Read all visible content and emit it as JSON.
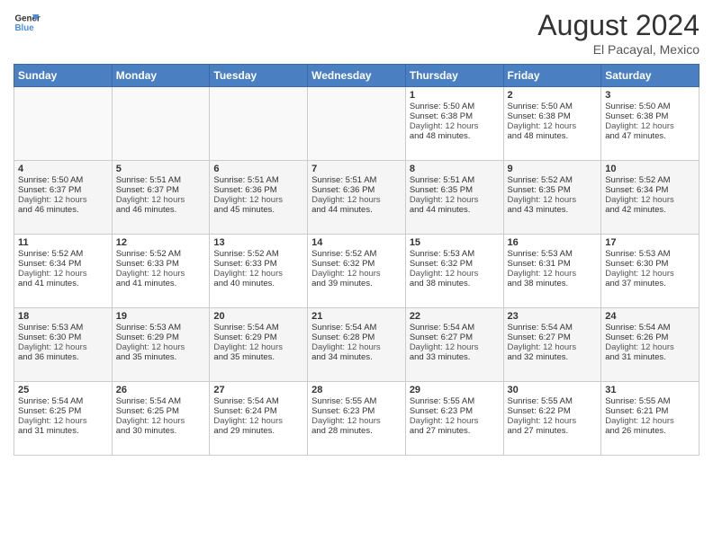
{
  "logo": {
    "line1": "General",
    "line2": "Blue"
  },
  "title": "August 2024",
  "location": "El Pacayal, Mexico",
  "days_of_week": [
    "Sunday",
    "Monday",
    "Tuesday",
    "Wednesday",
    "Thursday",
    "Friday",
    "Saturday"
  ],
  "weeks": [
    [
      {
        "day": "",
        "info": ""
      },
      {
        "day": "",
        "info": ""
      },
      {
        "day": "",
        "info": ""
      },
      {
        "day": "",
        "info": ""
      },
      {
        "day": "1",
        "info": "Sunrise: 5:50 AM\nSunset: 6:38 PM\nDaylight: 12 hours\nand 48 minutes."
      },
      {
        "day": "2",
        "info": "Sunrise: 5:50 AM\nSunset: 6:38 PM\nDaylight: 12 hours\nand 48 minutes."
      },
      {
        "day": "3",
        "info": "Sunrise: 5:50 AM\nSunset: 6:38 PM\nDaylight: 12 hours\nand 47 minutes."
      }
    ],
    [
      {
        "day": "4",
        "info": "Sunrise: 5:50 AM\nSunset: 6:37 PM\nDaylight: 12 hours\nand 46 minutes."
      },
      {
        "day": "5",
        "info": "Sunrise: 5:51 AM\nSunset: 6:37 PM\nDaylight: 12 hours\nand 46 minutes."
      },
      {
        "day": "6",
        "info": "Sunrise: 5:51 AM\nSunset: 6:36 PM\nDaylight: 12 hours\nand 45 minutes."
      },
      {
        "day": "7",
        "info": "Sunrise: 5:51 AM\nSunset: 6:36 PM\nDaylight: 12 hours\nand 44 minutes."
      },
      {
        "day": "8",
        "info": "Sunrise: 5:51 AM\nSunset: 6:35 PM\nDaylight: 12 hours\nand 44 minutes."
      },
      {
        "day": "9",
        "info": "Sunrise: 5:52 AM\nSunset: 6:35 PM\nDaylight: 12 hours\nand 43 minutes."
      },
      {
        "day": "10",
        "info": "Sunrise: 5:52 AM\nSunset: 6:34 PM\nDaylight: 12 hours\nand 42 minutes."
      }
    ],
    [
      {
        "day": "11",
        "info": "Sunrise: 5:52 AM\nSunset: 6:34 PM\nDaylight: 12 hours\nand 41 minutes."
      },
      {
        "day": "12",
        "info": "Sunrise: 5:52 AM\nSunset: 6:33 PM\nDaylight: 12 hours\nand 41 minutes."
      },
      {
        "day": "13",
        "info": "Sunrise: 5:52 AM\nSunset: 6:33 PM\nDaylight: 12 hours\nand 40 minutes."
      },
      {
        "day": "14",
        "info": "Sunrise: 5:52 AM\nSunset: 6:32 PM\nDaylight: 12 hours\nand 39 minutes."
      },
      {
        "day": "15",
        "info": "Sunrise: 5:53 AM\nSunset: 6:32 PM\nDaylight: 12 hours\nand 38 minutes."
      },
      {
        "day": "16",
        "info": "Sunrise: 5:53 AM\nSunset: 6:31 PM\nDaylight: 12 hours\nand 38 minutes."
      },
      {
        "day": "17",
        "info": "Sunrise: 5:53 AM\nSunset: 6:30 PM\nDaylight: 12 hours\nand 37 minutes."
      }
    ],
    [
      {
        "day": "18",
        "info": "Sunrise: 5:53 AM\nSunset: 6:30 PM\nDaylight: 12 hours\nand 36 minutes."
      },
      {
        "day": "19",
        "info": "Sunrise: 5:53 AM\nSunset: 6:29 PM\nDaylight: 12 hours\nand 35 minutes."
      },
      {
        "day": "20",
        "info": "Sunrise: 5:54 AM\nSunset: 6:29 PM\nDaylight: 12 hours\nand 35 minutes."
      },
      {
        "day": "21",
        "info": "Sunrise: 5:54 AM\nSunset: 6:28 PM\nDaylight: 12 hours\nand 34 minutes."
      },
      {
        "day": "22",
        "info": "Sunrise: 5:54 AM\nSunset: 6:27 PM\nDaylight: 12 hours\nand 33 minutes."
      },
      {
        "day": "23",
        "info": "Sunrise: 5:54 AM\nSunset: 6:27 PM\nDaylight: 12 hours\nand 32 minutes."
      },
      {
        "day": "24",
        "info": "Sunrise: 5:54 AM\nSunset: 6:26 PM\nDaylight: 12 hours\nand 31 minutes."
      }
    ],
    [
      {
        "day": "25",
        "info": "Sunrise: 5:54 AM\nSunset: 6:25 PM\nDaylight: 12 hours\nand 31 minutes."
      },
      {
        "day": "26",
        "info": "Sunrise: 5:54 AM\nSunset: 6:25 PM\nDaylight: 12 hours\nand 30 minutes."
      },
      {
        "day": "27",
        "info": "Sunrise: 5:54 AM\nSunset: 6:24 PM\nDaylight: 12 hours\nand 29 minutes."
      },
      {
        "day": "28",
        "info": "Sunrise: 5:55 AM\nSunset: 6:23 PM\nDaylight: 12 hours\nand 28 minutes."
      },
      {
        "day": "29",
        "info": "Sunrise: 5:55 AM\nSunset: 6:23 PM\nDaylight: 12 hours\nand 27 minutes."
      },
      {
        "day": "30",
        "info": "Sunrise: 5:55 AM\nSunset: 6:22 PM\nDaylight: 12 hours\nand 27 minutes."
      },
      {
        "day": "31",
        "info": "Sunrise: 5:55 AM\nSunset: 6:21 PM\nDaylight: 12 hours\nand 26 minutes."
      }
    ]
  ]
}
